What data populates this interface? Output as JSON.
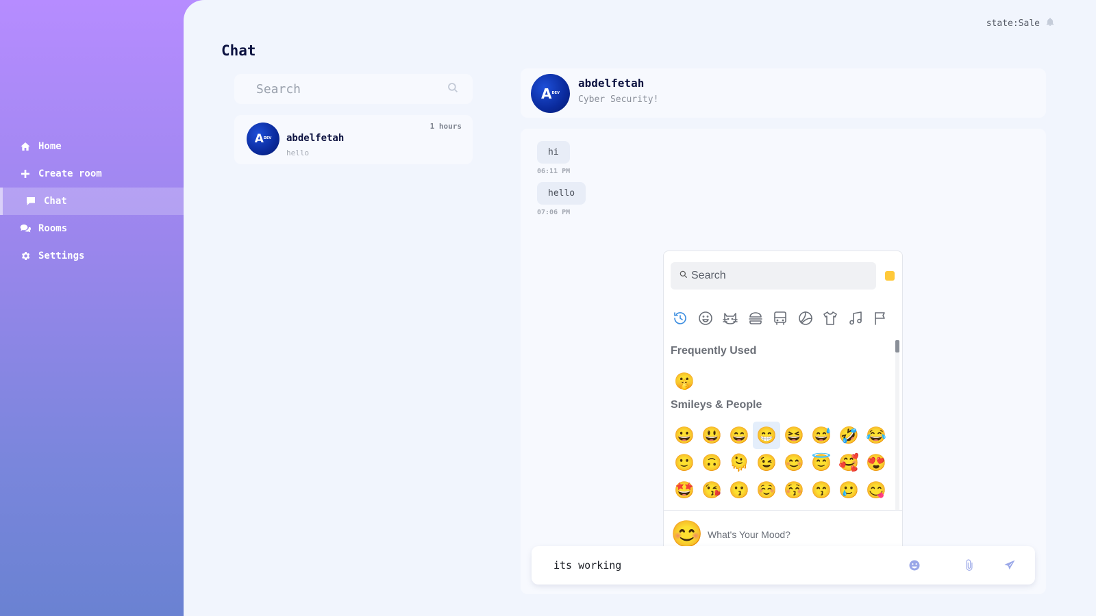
{
  "sidebar": {
    "items": [
      {
        "label": "Home",
        "icon": "home-icon"
      },
      {
        "label": "Create room",
        "icon": "plus-icon"
      },
      {
        "label": "Chat",
        "icon": "chat-bubble-icon",
        "active": true
      },
      {
        "label": "Rooms",
        "icon": "comments-icon"
      },
      {
        "label": "Settings",
        "icon": "gear-icon"
      }
    ]
  },
  "header": {
    "state_text": "state:Sale"
  },
  "page": {
    "title": "Chat"
  },
  "search": {
    "placeholder": "Search"
  },
  "conversations": [
    {
      "name": "abdelfetah",
      "last_message": "hello",
      "time": "1 hours"
    }
  ],
  "avatar": {
    "text_big": "A",
    "text_small": "DEV"
  },
  "chat_header": {
    "name": "abdelfetah",
    "subtitle": "Cyber Security!"
  },
  "messages": [
    {
      "text": "hi",
      "time": "06:11 PM"
    },
    {
      "text": "hello",
      "time": "07:06 PM"
    }
  ],
  "emoji_picker": {
    "search_placeholder": "Search",
    "skin_tone_color": "#ffc93a",
    "categories": [
      "recent-icon",
      "smiley-icon",
      "cat-icon",
      "burger-icon",
      "bus-icon",
      "ball-icon",
      "shirt-icon",
      "music-icon",
      "flag-icon"
    ],
    "frequently_used_label": "Frequently Used",
    "frequently_used": [
      "🤫"
    ],
    "smileys_label": "Smileys & People",
    "smileys_rows": [
      [
        "😀",
        "😃",
        "😄",
        "😁",
        "😆",
        "😅",
        "🤣",
        "😂"
      ],
      [
        "🙂",
        "🙃",
        "🫠",
        "😉",
        "😊",
        "😇",
        "🥰",
        "😍"
      ],
      [
        "🤩",
        "😘",
        "😗",
        "☺️",
        "😚",
        "😙",
        "🥲",
        "😋"
      ]
    ],
    "preview_emoji": "😊",
    "preview_text": "What's Your Mood?"
  },
  "composer": {
    "text": "its working"
  },
  "colors": {
    "accent": "#9aa7e8",
    "title": "#0c1240"
  }
}
